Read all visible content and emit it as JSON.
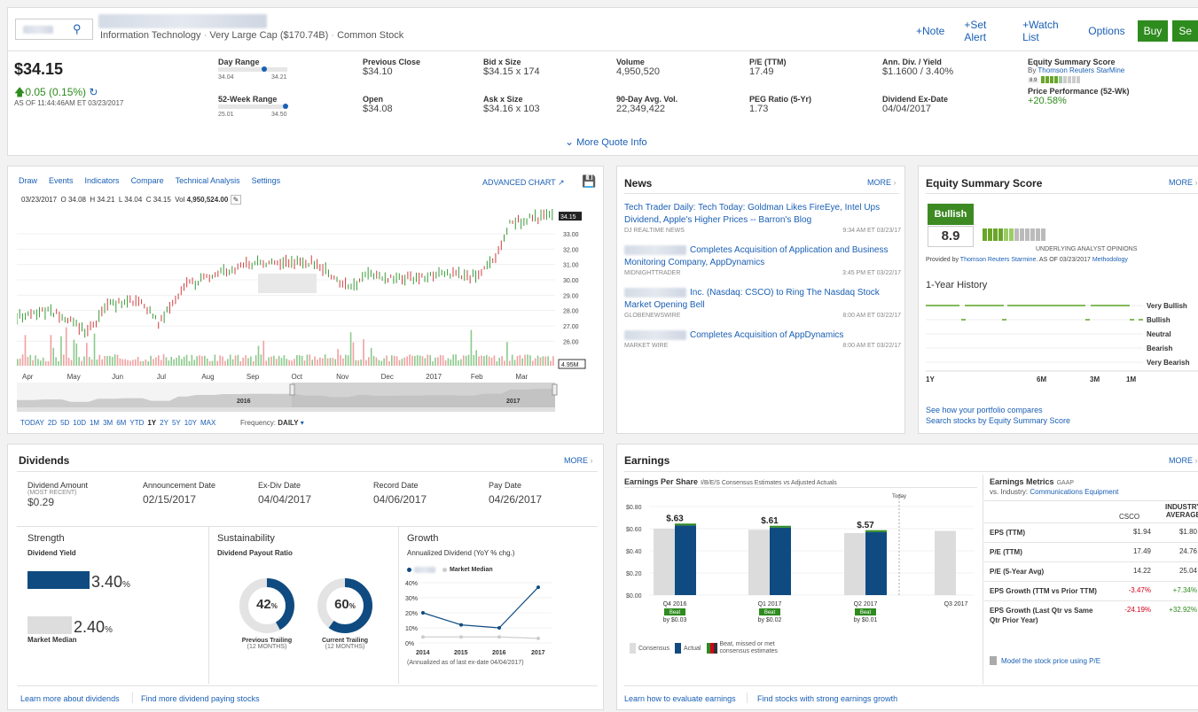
{
  "header": {
    "sector": "Information Technology",
    "cap": "Very Large Cap ($170.74B)",
    "stock_type": "Common Stock",
    "note": "+Note",
    "alert": "+Set Alert",
    "watch": "+Watch List",
    "options": "Options",
    "buy": "Buy",
    "sell": "Se"
  },
  "quote": {
    "price": "$34.15",
    "change": "0.05 (0.15%)",
    "as_of": "AS OF 11:44:46AM ET 03/23/2017",
    "day_range_label": "Day Range",
    "day_low": "34.04",
    "day_high": "34.21",
    "wk52_label": "52-Week Range",
    "wk_low": "25.01",
    "wk_high": "34.50",
    "prev_close_label": "Previous Close",
    "prev_close": "$34.10",
    "open_label": "Open",
    "open": "$34.08",
    "bid_label": "Bid x Size",
    "bid": "$34.15 x 174",
    "ask_label": "Ask x Size",
    "ask": "$34.16 x 103",
    "volume_label": "Volume",
    "volume": "4,950,520",
    "avgvol_label": "90-Day Avg. Vol.",
    "avgvol": "22,349,422",
    "pe_label": "P/E (TTM)",
    "pe": "17.49",
    "peg_label": "PEG Ratio (5-Yr)",
    "peg": "1.73",
    "div_label": "Ann. Div. / Yield",
    "div": "$1.1600 / 3.40%",
    "exdate_label": "Dividend Ex-Date",
    "exdate": "04/04/2017",
    "ess_label": "Equity Summary Score",
    "ess_by": "By",
    "ess_provider": "Thomson Reuters StarMine",
    "ess_small": "8.9",
    "perf_label": "Price Performance (52-Wk)",
    "perf": "+20.58%",
    "more_info": "More Quote Info"
  },
  "chart": {
    "tabs": [
      "Draw",
      "Events",
      "Indicators",
      "Compare",
      "Technical Analysis",
      "Settings"
    ],
    "advanced": "ADVANCED CHART",
    "info": {
      "date": "03/23/2017",
      "o": "O 34.08",
      "h": "H 34.21",
      "l": "L 34.04",
      "c": "C 34.15",
      "vol_label": "Vol",
      "vol": "4,950,524.00"
    },
    "y_ticks": [
      "33.00",
      "32.00",
      "31.00",
      "30.00",
      "29.00",
      "28.00",
      "27.00",
      "26.00"
    ],
    "last_price": "34.15",
    "vol_tag": "4.95M",
    "x_labels": [
      "Apr",
      "May",
      "Jun",
      "Jul",
      "Aug",
      "Sep",
      "Oct",
      "Nov",
      "Dec",
      "2017",
      "Feb",
      "Mar"
    ],
    "nav_years": [
      "2016",
      "2017"
    ],
    "ranges": [
      "TODAY",
      "2D",
      "5D",
      "10D",
      "1M",
      "3M",
      "6M",
      "YTD",
      "1Y",
      "2Y",
      "5Y",
      "10Y",
      "MAX"
    ],
    "freq_label": "Frequency:",
    "freq": "DAILY"
  },
  "chart_data": {
    "type": "line",
    "title": "",
    "x_range": [
      "2016-03-23",
      "2017-03-23"
    ],
    "ylim": [
      25.5,
      34.5
    ],
    "x": [
      "2016-03-23",
      "2016-04-15",
      "2016-05-10",
      "2016-05-25",
      "2016-06-15",
      "2016-06-27",
      "2016-07-15",
      "2016-08-10",
      "2016-08-25",
      "2016-09-15",
      "2016-10-10",
      "2016-10-25",
      "2016-11-04",
      "2016-11-15",
      "2016-12-05",
      "2016-12-20",
      "2017-01-10",
      "2017-01-25",
      "2017-02-10",
      "2017-02-20",
      "2017-03-05",
      "2017-03-23"
    ],
    "y": [
      27.6,
      28.0,
      26.6,
      28.4,
      28.7,
      27.2,
      29.6,
      30.5,
      31.0,
      31.2,
      31.1,
      30.2,
      29.3,
      30.5,
      30.0,
      30.2,
      30.4,
      30.2,
      31.2,
      33.6,
      34.0,
      34.15
    ],
    "volume_peak_months": [
      "Apr",
      "May",
      "Aug",
      "Sep",
      "Nov",
      "Feb"
    ]
  },
  "news": {
    "title": "News",
    "more": "MORE",
    "items": [
      {
        "pre": "",
        "text": "Tech Trader Daily: Tech Today: Goldman Likes FireEye, Intel Ups Dividend, Apple's Higher Prices -- Barron's Blog",
        "source": "DJ REALTIME NEWS",
        "time": "9:34 AM ET 03/23/17"
      },
      {
        "pre": "blur",
        "text": "Completes Acquisition of Application and Business Monitoring Company, AppDynamics",
        "source": "MIDNIGHTTRADER",
        "time": "3:45 PM ET 03/22/17"
      },
      {
        "pre": "blur",
        "text": "Inc. (Nasdaq: CSCO) to Ring The Nasdaq Stock Market Opening Bell",
        "source": "GLOBENEWSWIRE",
        "time": "8:00 AM ET 03/22/17"
      },
      {
        "pre": "blur",
        "text": "Completes Acquisition of AppDynamics",
        "source": "MARKET WIRE",
        "time": "8:00 AM ET 03/22/17"
      }
    ]
  },
  "ess": {
    "title": "Equity Summary Score",
    "more": "MORE",
    "rating": "Bullish",
    "score": "8.9",
    "opinions": "UNDERLYING ANALYST OPINIONS",
    "provided": "Provided by",
    "provider": "Thomson Reuters Starmine",
    "asof": "AS OF 03/23/2017",
    "methodology": "Methodology",
    "history_title": "1-Year History",
    "levels": [
      "Very Bullish",
      "Bullish",
      "Neutral",
      "Bearish",
      "Very Bearish"
    ],
    "periods": [
      "1Y",
      "6M",
      "3M",
      "1M"
    ],
    "link1": "See how your portfolio compares",
    "link2": "Search stocks by Equity Summary Score"
  },
  "dividends": {
    "title": "Dividends",
    "more": "MORE",
    "amount_label": "Dividend Amount",
    "amount_sub": "(MOST RECENT)",
    "amount": "$0.29",
    "ann_label": "Announcement Date",
    "ann": "02/15/2017",
    "ex_label": "Ex-Div Date",
    "ex": "04/04/2017",
    "rec_label": "Record Date",
    "rec": "04/06/2017",
    "pay_label": "Pay Date",
    "pay": "04/26/2017",
    "strength": "Strength",
    "yield_label": "Dividend Yield",
    "yield": "3.40",
    "median_yield": "2.40",
    "pct": "%",
    "median_label": "Market Median",
    "sustain": "Sustainability",
    "payout_label": "Dividend Payout Ratio",
    "prev": "42",
    "curr": "60",
    "prev_label": "Previous Trailing",
    "curr_label": "Current Trailing",
    "months": "(12 MONTHS)",
    "growth": "Growth",
    "growth_sub": "Annualized Dividend (YoY % chg.)",
    "legend_median": "Market Median",
    "g_ticks": [
      "40%",
      "30%",
      "20%",
      "10%",
      "0%"
    ],
    "g_years": [
      "2014",
      "2015",
      "2016",
      "2017"
    ],
    "g_note": "(Annualized as of last ex-date 04/04/2017)",
    "link1": "Learn more about dividends",
    "link2": "Find more dividend paying stocks"
  },
  "growth_chart": {
    "company": [
      20,
      12,
      10,
      37
    ],
    "median": [
      4,
      4,
      4,
      3
    ]
  },
  "earnings": {
    "title": "Earnings",
    "more": "MORE",
    "eps_title": "Earnings Per Share",
    "eps_sub": "I/B/E/S Consensus Estimates vs Adjusted Actuals",
    "today": "Today",
    "y_ticks": [
      "$0.80",
      "$0.60",
      "$0.40",
      "$0.20",
      "$0.00"
    ],
    "quarters": [
      {
        "q": "Q4 2016",
        "actual": "$.63",
        "beat": "Beat",
        "by": "by $0.03"
      },
      {
        "q": "Q1 2017",
        "actual": "$.61",
        "beat": "Beat",
        "by": "by $0.02"
      },
      {
        "q": "Q2 2017",
        "actual": "$.57",
        "beat": "Beat",
        "by": "by $0.01"
      },
      {
        "q": "Q3 2017",
        "actual": "",
        "beat": "",
        "by": ""
      }
    ],
    "legend_consensus": "Consensus",
    "legend_actual": "Actual",
    "legend_beat": "Beat, missed or met consensus estimates",
    "metrics_title": "Earnings Metrics",
    "gaap": "GAAP",
    "vs": "vs. Industry:",
    "industry": "Communications Equipment",
    "col1": "CSCO",
    "col2": "INDUSTRY",
    "col2b": "AVERAGE",
    "rows": [
      {
        "label": "EPS (TTM)",
        "a": "$1.94",
        "b": "$1.80"
      },
      {
        "label": "P/E (TTM)",
        "a": "17.49",
        "b": "24.76"
      },
      {
        "label": "P/E (5-Year Avg)",
        "a": "14.22",
        "b": "25.04"
      },
      {
        "label": "EPS Growth (TTM vs Prior TTM)",
        "a": "-3.47%",
        "b": "+7.34%"
      },
      {
        "label": "EPS Growth (Last Qtr vs Same Qtr Prior Year)",
        "a": "-24.19%",
        "b": "+32.92%"
      }
    ],
    "model": "Model the stock price using P/E",
    "link1": "Learn how to evaluate earnings",
    "link2": "Find stocks with strong earnings growth"
  },
  "eps_chart": {
    "consensus": [
      0.6,
      0.59,
      0.56,
      0.58
    ],
    "actual": [
      0.63,
      0.61,
      0.57,
      null
    ]
  },
  "colors": {
    "accent": "#1a5fb4",
    "green": "#2e8b1e",
    "navy": "#0f4b80",
    "red": "#d0021b"
  }
}
